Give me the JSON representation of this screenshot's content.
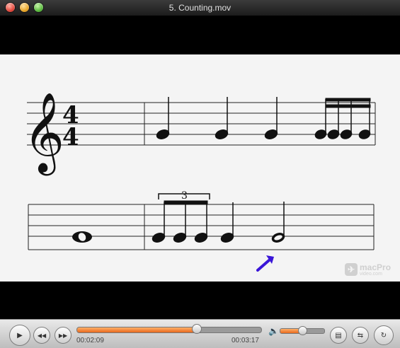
{
  "window": {
    "title": "5. Counting.mov"
  },
  "score": {
    "tuplet_number": "3",
    "time_signature": {
      "top": "4",
      "bottom": "4"
    }
  },
  "watermark": {
    "brand": "macPro",
    "sub": "video.com"
  },
  "controls": {
    "elapsed": "00:02:09",
    "total": "00:03:17",
    "progress": 0.65,
    "volume": 0.5
  },
  "icons": {
    "play": "▶",
    "prev": "◀◀",
    "next": "▶▶",
    "volume": "🔈",
    "clips": "▤",
    "share": "⇆",
    "loop": "↻"
  }
}
